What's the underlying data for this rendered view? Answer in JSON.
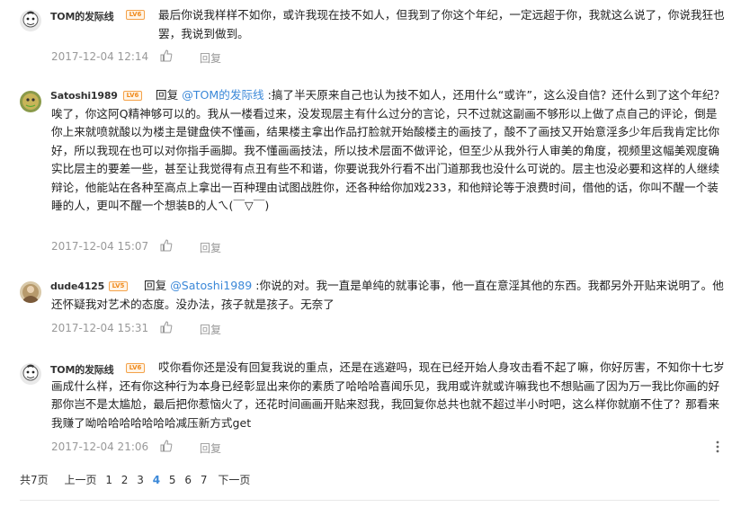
{
  "comments": [
    {
      "username": "TOM的发际线",
      "level": "LV6",
      "reply_prefix": "",
      "mention": "",
      "body": "最后你说我样样不如你，或许我现在技不如人，但我到了你这个年纪，一定远超于你，我就这么说了，你说我狂也罢，我说到做到。",
      "date": "2017-12-04 12:14",
      "reply_label": "回复",
      "avatar": "tom-avatar"
    },
    {
      "username": "Satoshi1989",
      "level": "LV6",
      "reply_prefix": "回复 ",
      "mention": "@TOM的发际线",
      "body": " :搞了半天原来自己也认为技不如人，还用什么“或许”，这么没自信？还什么到了这个年纪？唉了，你这阿Q精神够可以的。我从一楼看过来，没发现层主有什么过分的言论，只不过就这副画不够形以上做了点自己的评论，倒是你上来就喷就酸以为楼主是键盘侠不懂画，结果楼主拿出作品打脸就开始酸楼主的画技了，酸不了画技又开始意淫多少年后我肯定比你好，所以我现在也可以对你指手画脚。我不懂画画技法，所以技术层面不做评论，但至少从我外行人审美的角度，视频里这幅美观度确实比层主的要差一些，甚至让我觉得有点丑有些不和谐，你要说我外行看不出门道那我也没什么可说的。层主也没必要和这样的人继续辩论，他能站在各种至高点上拿出一百种理由试图战胜你，还各种给你加戏233，和他辩论等于浪费时间，借他的话，你叫不醒一个装睡的人，更叫不醒一个想装B的人ㄟ(￣▽￣)",
      "date": "2017-12-04 15:07",
      "reply_label": "回复",
      "avatar": "satoshi-avatar"
    },
    {
      "username": "dude4125",
      "level": "LV5",
      "reply_prefix": "回复 ",
      "mention": "@Satoshi1989",
      "body": " :你说的对。我一直是单纯的就事论事，他一直在意淫其他的东西。我都另外开贴来说明了。他还怀疑我对艺术的态度。没办法，孩子就是孩子。无奈了",
      "date": "2017-12-04 15:31",
      "reply_label": "回复",
      "avatar": "dude-avatar"
    },
    {
      "username": "TOM的发际线",
      "level": "LV6",
      "reply_prefix": "",
      "mention": "",
      "body": "哎你看你还是没有回复我说的重点，还是在逃避吗，现在已经开始人身攻击看不起了嘛，你好厉害，不知你十七岁画成什么样，还有你这种行为本身已经彰显出来你的素质了哈哈哈喜闻乐见，我用或许就或许嘛我也不想贴画了因为万一我比你画的好那你岂不是太尴尬，最后把你惹恼火了，还花时间画画开贴来怼我，我回复你总共也就不超过半小时吧，这么样你就崩不住了？那看来我赚了呦哈哈哈哈哈哈哈减压新方式get",
      "date": "2017-12-04 21:06",
      "reply_label": "回复",
      "avatar": "tom-avatar"
    }
  ],
  "pager": {
    "total": "共7页",
    "prev": "上一页",
    "pages": [
      "1",
      "2",
      "3",
      "4",
      "5",
      "6",
      "7"
    ],
    "current": "4",
    "next": "下一页"
  },
  "more_icon": "⋮",
  "colors": {
    "link": "#3b88d8",
    "meta": "#999999",
    "level_badge": "#f08a1c"
  }
}
